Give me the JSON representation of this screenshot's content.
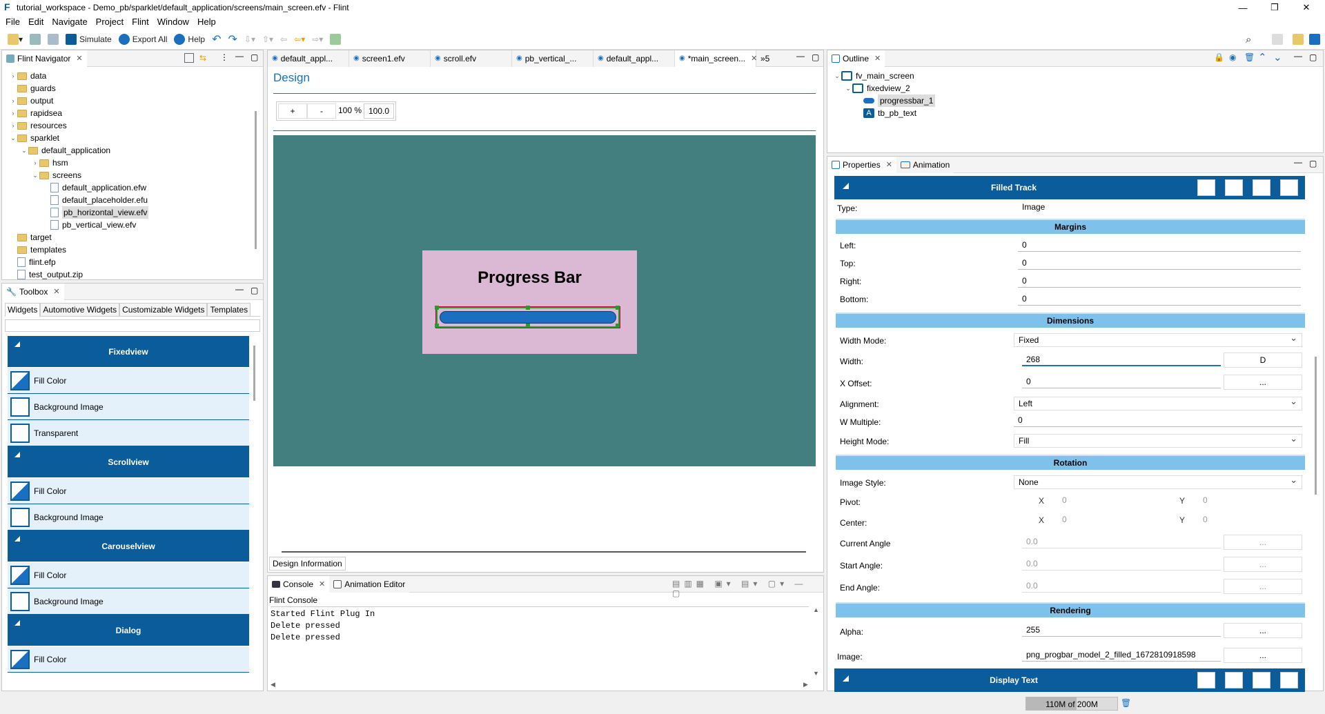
{
  "window": {
    "title": "tutorial_workspace - Demo_pb/sparklet/default_application/screens/main_screen.efv - Flint"
  },
  "menu": [
    "File",
    "Edit",
    "Navigate",
    "Project",
    "Flint",
    "Window",
    "Help"
  ],
  "toolbar": {
    "simulate": "Simulate",
    "export_all": "Export All",
    "help": "Help"
  },
  "navigator": {
    "title": "Flint Navigator",
    "items": [
      {
        "label": "data",
        "indent": 1,
        "type": "folder",
        "arrow": "›"
      },
      {
        "label": "guards",
        "indent": 1,
        "type": "folder",
        "arrow": ""
      },
      {
        "label": "output",
        "indent": 1,
        "type": "folder",
        "arrow": "›"
      },
      {
        "label": "rapidsea",
        "indent": 1,
        "type": "folder",
        "arrow": "›"
      },
      {
        "label": "resources",
        "indent": 1,
        "type": "folder",
        "arrow": "›"
      },
      {
        "label": "sparklet",
        "indent": 1,
        "type": "folder",
        "arrow": "⌄"
      },
      {
        "label": "default_application",
        "indent": 2,
        "type": "folder",
        "arrow": "⌄"
      },
      {
        "label": "hsm",
        "indent": 3,
        "type": "folder",
        "arrow": "›"
      },
      {
        "label": "screens",
        "indent": 3,
        "type": "folder",
        "arrow": "⌄"
      },
      {
        "label": "default_application.efw",
        "indent": 4,
        "type": "file",
        "arrow": ""
      },
      {
        "label": "default_placeholder.efu",
        "indent": 4,
        "type": "file",
        "arrow": ""
      },
      {
        "label": "pb_horizontal_view.efv",
        "indent": 4,
        "type": "file",
        "arrow": "",
        "selected": true
      },
      {
        "label": "pb_vertical_view.efv",
        "indent": 4,
        "type": "file",
        "arrow": ""
      },
      {
        "label": "target",
        "indent": 1,
        "type": "folder",
        "arrow": ""
      },
      {
        "label": "templates",
        "indent": 1,
        "type": "folder",
        "arrow": ""
      },
      {
        "label": "flint.efp",
        "indent": 1,
        "type": "file",
        "arrow": ""
      },
      {
        "label": "test_output.zip",
        "indent": 1,
        "type": "file",
        "arrow": ""
      }
    ]
  },
  "toolbox": {
    "title": "Toolbox",
    "tabs": [
      "Widgets",
      "Automotive Widgets",
      "Customizable Widgets",
      "Templates"
    ],
    "groups": [
      {
        "name": "Fixedview",
        "items": [
          "Fill Color",
          "Background Image",
          "Transparent"
        ]
      },
      {
        "name": "Scrollview",
        "items": [
          "Fill Color",
          "Background Image"
        ]
      },
      {
        "name": "Carouselview",
        "items": [
          "Fill Color",
          "Background Image"
        ]
      },
      {
        "name": "Dialog",
        "items": [
          "Fill Color"
        ]
      }
    ]
  },
  "editor": {
    "tabs": [
      "default_appl...",
      "screen1.efv",
      "scroll.efv",
      "pb_vertical_...",
      "default_appl...",
      "*main_screen..."
    ],
    "overflow": "»5",
    "design_label": "Design",
    "zoom_plus": "+",
    "zoom_minus": "-",
    "zoom_pct": "100 %",
    "zoom_val": "100.0",
    "widget_title": "Progress Bar",
    "bottom_tab": "Design Information"
  },
  "console": {
    "tabs": [
      "Console",
      "Animation Editor"
    ],
    "header": "Flint Console",
    "lines": [
      "Started Flint Plug In",
      "Delete pressed",
      "Delete pressed"
    ]
  },
  "outline": {
    "title": "Outline",
    "items": [
      {
        "label": "fv_main_screen",
        "indent": 0
      },
      {
        "label": "fixedview_2",
        "indent": 1
      },
      {
        "label": "progressbar_1",
        "indent": 2,
        "selected": true
      },
      {
        "label": "tb_pb_text",
        "indent": 2
      }
    ]
  },
  "properties": {
    "tabs": [
      "Properties",
      "Animation"
    ],
    "header": "Filled Track",
    "type_label": "Type:",
    "type_value": "Image",
    "margins": {
      "title": "Margins",
      "left_l": "Left:",
      "left": "0",
      "top_l": "Top:",
      "top": "0",
      "right_l": "Right:",
      "right": "0",
      "bottom_l": "Bottom:",
      "bottom": "0"
    },
    "dimensions": {
      "title": "Dimensions",
      "wmode_l": "Width Mode:",
      "wmode": "Fixed",
      "width_l": "Width:",
      "width": "268",
      "width_btn": "D",
      "xoff_l": "X Offset:",
      "xoff": "0",
      "xoff_btn": "...",
      "align_l": "Alignment:",
      "align": "Left",
      "wmul_l": "W Multiple:",
      "wmul": "0",
      "hmode_l": "Height Mode:",
      "hmode": "Fill"
    },
    "rotation": {
      "title": "Rotation",
      "style_l": "Image Style:",
      "style": "None",
      "pivot_l": "Pivot:",
      "center_l": "Center:",
      "x": "X",
      "y": "Y",
      "zero": "0",
      "cur_l": "Current Angle",
      "cur": "0.0",
      "start_l": "Start Angle:",
      "start": "0.0",
      "end_l": "End Angle:",
      "end": "0.0",
      "btn": "..."
    },
    "rendering": {
      "title": "Rendering",
      "alpha_l": "Alpha:",
      "alpha": "255",
      "image_l": "Image:",
      "image": "png_progbar_model_2_filled_1672810918598",
      "btn": "..."
    },
    "footer_header": "Display Text"
  },
  "status": {
    "memory": "110M of 200M"
  },
  "colors": {
    "accent": "#0a5c9a",
    "section": "#7ec1ea",
    "canvas": "#447f7f",
    "widget": "#dbb8d4",
    "bar": "#1a6fc0"
  }
}
